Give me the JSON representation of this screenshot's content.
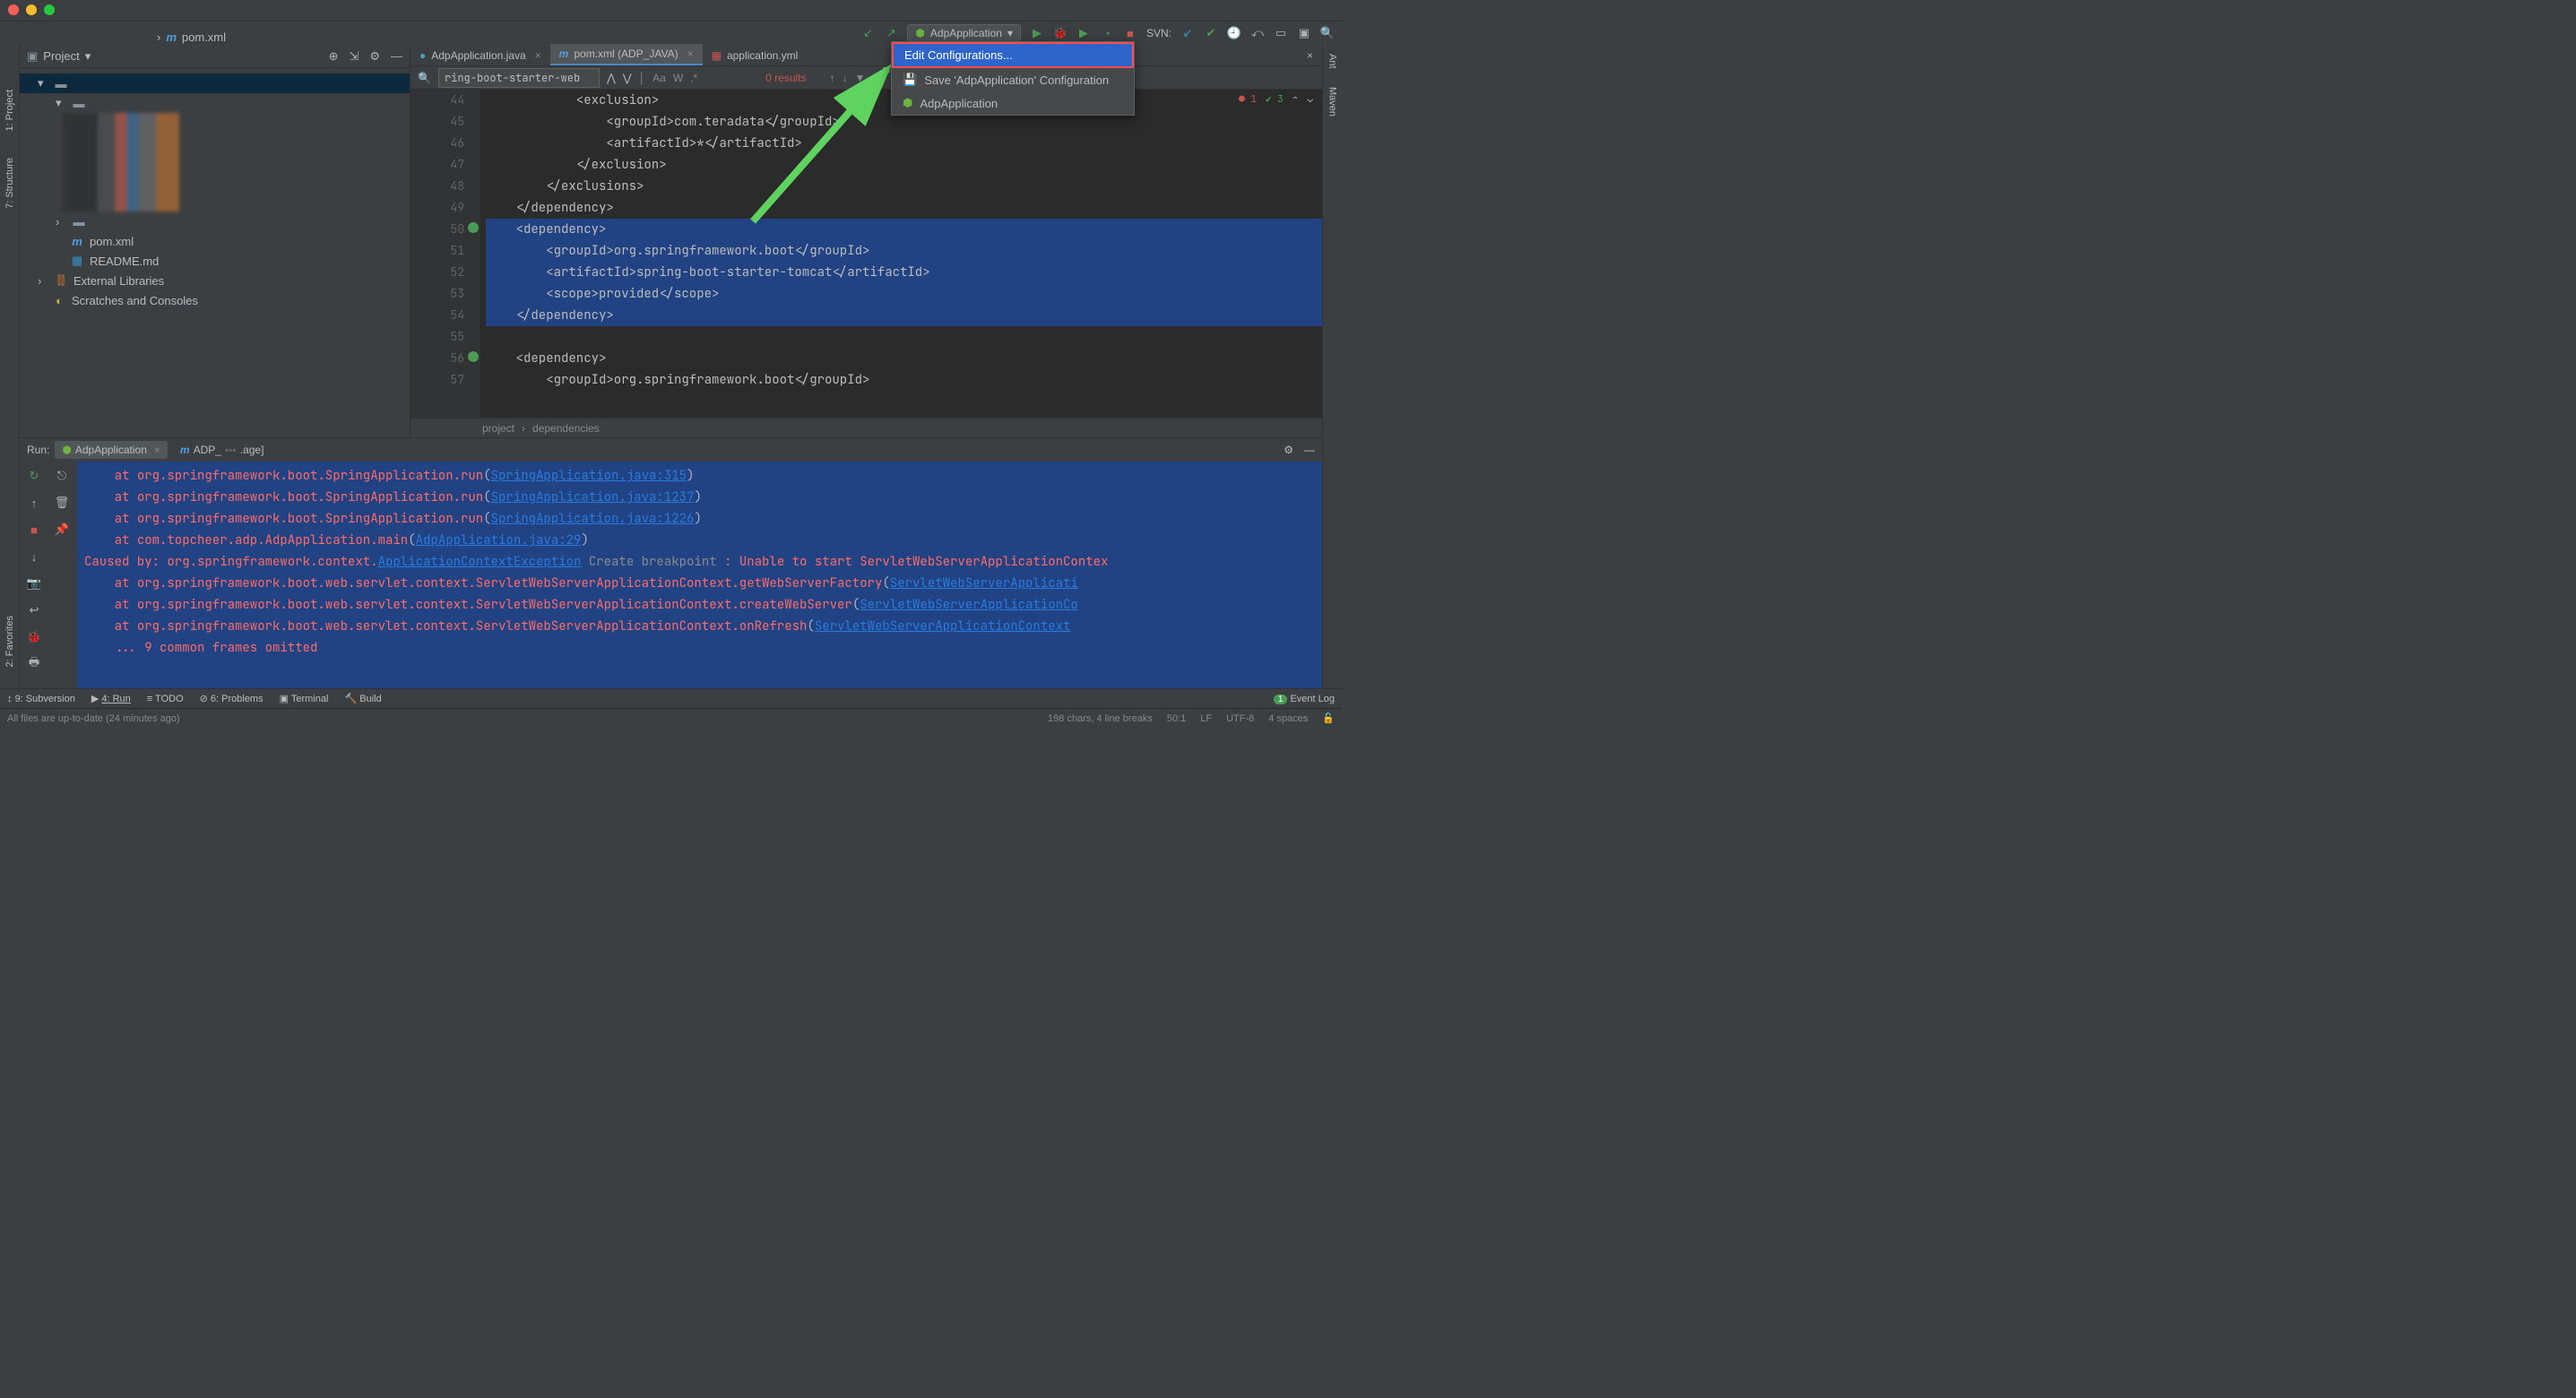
{
  "toolbar": {
    "nav_tab_file": "pom.xml",
    "run_config_selected": "AdpApplication",
    "svn_label": "SVN:"
  },
  "config_popup": {
    "edit": "Edit Configurations...",
    "save": "Save 'AdpApplication' Configuration",
    "app": "AdpApplication"
  },
  "project": {
    "title": "Project",
    "files": {
      "pom": "pom.xml",
      "readme": "README.md",
      "ext": "External Libraries",
      "scratch": "Scratches and Consoles"
    }
  },
  "editor": {
    "tabs": {
      "t1": "AdpApplication.java",
      "t2": "pom.xml (ADP_JAVA)",
      "t3": "application.yml"
    },
    "find_text": "ring-boot-starter-web",
    "results": "0 results",
    "inspection_err": "1",
    "inspection_ok": "3",
    "lines": {
      "l44": "            <exclusion>",
      "l45": "                <groupId>com.teradata</groupId>",
      "l46": "                <artifactId>*</artifactId>",
      "l47": "            </exclusion>",
      "l48": "        </exclusions>",
      "l49": "    </dependency>",
      "l50": "    <dependency>",
      "l51": "        <groupId>org.springframework.boot</groupId>",
      "l52": "        <artifactId>spring-boot-starter-tomcat</artifactId>",
      "l53": "        <scope>provided</scope>",
      "l54": "    </dependency>",
      "l55": "",
      "l56": "    <dependency>",
      "l57": "        <groupId>org.springframework.boot</groupId>"
    },
    "gutter_start": 44,
    "gutter_end": 57,
    "crumb1": "project",
    "crumb2": "dependencies"
  },
  "run": {
    "title": "Run:",
    "tab1": "AdpApplication",
    "tab2_prefix": "ADP_",
    "tab2_suffix": ".age]",
    "console_lines": [
      {
        "indent": "    ",
        "at": "at ",
        "pkg": "org.springframework.boot.SpringApplication.run",
        "op": "(",
        "link": "SpringApplication.java:315",
        "cl": ")"
      },
      {
        "indent": "    ",
        "at": "at ",
        "pkg": "org.springframework.boot.SpringApplication.run",
        "op": "(",
        "link": "SpringApplication.java:1237",
        "cl": ")"
      },
      {
        "indent": "    ",
        "at": "at ",
        "pkg": "org.springframework.boot.SpringApplication.run",
        "op": "(",
        "link": "SpringApplication.java:1226",
        "cl": ")"
      },
      {
        "indent": "    ",
        "at": "at ",
        "pkg": "com.topcheer.adp.AdpApplication.main",
        "op": "(",
        "link": "AdpApplication.java:29",
        "cl": ")"
      }
    ],
    "caused_pre": "Caused by: ",
    "caused_pkg": "org.springframework.context.",
    "caused_link": "ApplicationContextException",
    "caused_hint": " Create breakpoint ",
    "caused_msg": ": Unable to start ServletWebServerApplicationContex",
    "tail": [
      {
        "pkg": "org.springframework.boot.web.servlet.context.ServletWebServerApplicationContext.getWebServerFactory",
        "link": "ServletWebServerApplicati"
      },
      {
        "pkg": "org.springframework.boot.web.servlet.context.ServletWebServerApplicationContext.createWebServer",
        "link": "ServletWebServerApplicationCo"
      },
      {
        "pkg": "org.springframework.boot.web.servlet.context.ServletWebServerApplicationContext.onRefresh",
        "link": "ServletWebServerApplicationContext"
      }
    ],
    "omitted": "    ... 9 common frames omitted"
  },
  "status1": {
    "svn": "9: Subversion",
    "run": "4: Run",
    "todo": "TODO",
    "problems": "6: Problems",
    "terminal": "Terminal",
    "build": "Build",
    "event": "Event Log",
    "event_count": "1"
  },
  "status2": {
    "msg": "All files are up-to-date (24 minutes ago)",
    "chars": "198 chars, 4 line breaks",
    "pos": "50:1",
    "le": "LF",
    "enc": "UTF-8",
    "indent": "4 spaces"
  },
  "stripes": {
    "project": "1: Project",
    "structure": "7: Structure",
    "favorites": "2: Favorites",
    "ant": "Ant",
    "maven": "Maven"
  }
}
